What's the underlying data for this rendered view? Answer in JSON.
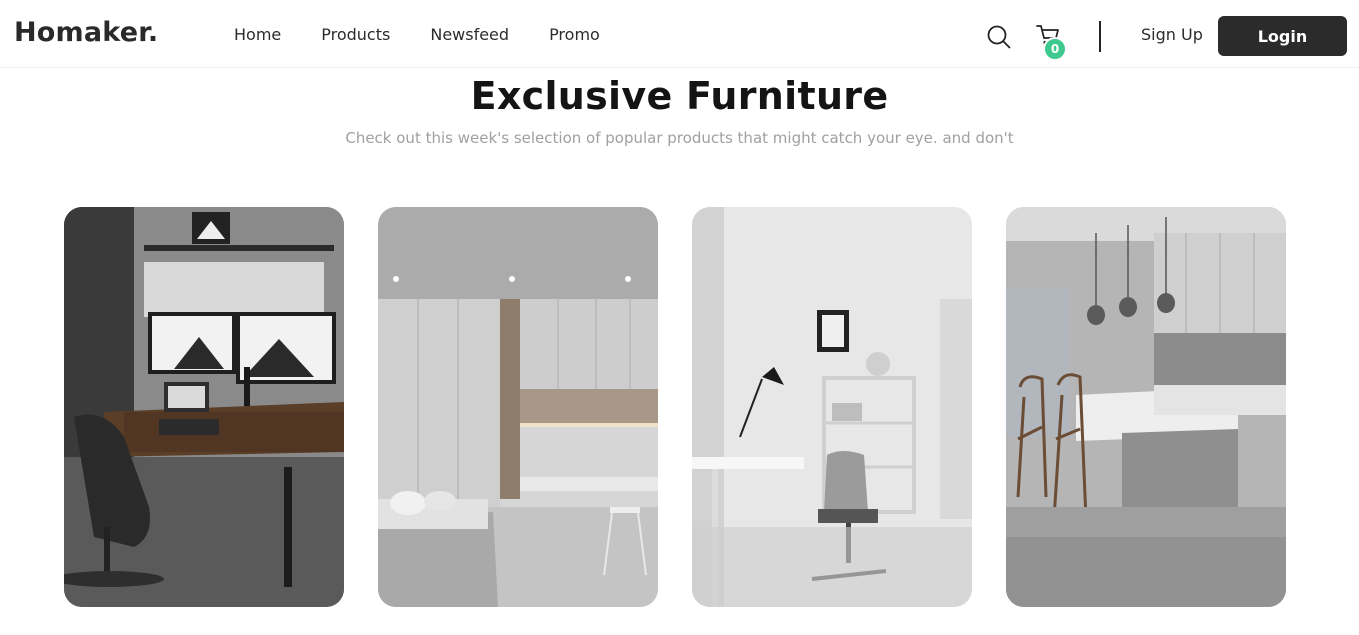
{
  "brand": {
    "logo": "Homaker."
  },
  "nav": {
    "items": [
      {
        "label": "Home"
      },
      {
        "label": "Products"
      },
      {
        "label": "Newsfeed"
      },
      {
        "label": "Promo"
      }
    ],
    "search_icon": "search-icon",
    "cart_icon": "cart-icon",
    "cart_count": "0",
    "signup_label": "Sign Up",
    "login_label": "Login"
  },
  "hero": {
    "title": "Exclusive Furniture",
    "subtitle": "Check out this week's selection of popular products that might catch your eye. and don't"
  },
  "products": [
    {
      "image": "workspace-desk-photo"
    },
    {
      "image": "bedroom-cabinet-photo"
    },
    {
      "image": "office-chair-photo"
    },
    {
      "image": "kitchen-island-photo"
    }
  ],
  "colors": {
    "accent": "#3fc98f",
    "button_dark": "#2b2b2b"
  }
}
